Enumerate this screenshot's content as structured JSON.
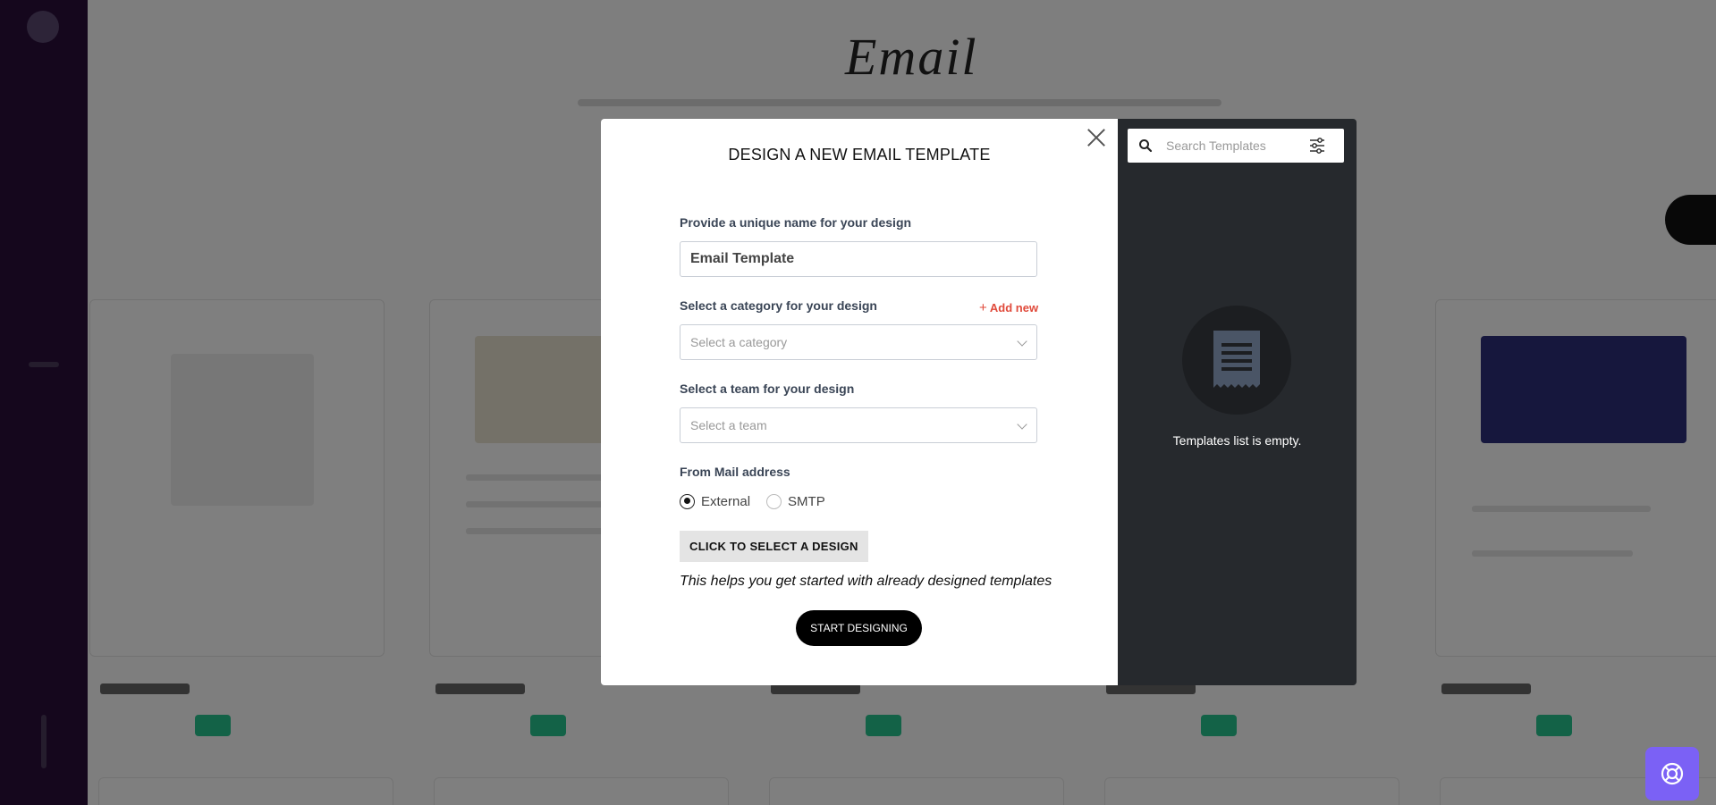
{
  "background": {
    "page_title": "Email"
  },
  "modal": {
    "title": "DESIGN A NEW EMAIL TEMPLATE",
    "name_label": "Provide a unique name for your design",
    "name_value": "Email Template",
    "category_label": "Select a category for your design",
    "add_new": "Add new",
    "category_placeholder": "Select a category",
    "team_label": "Select a team for your design",
    "team_placeholder": "Select a team",
    "from_label": "From Mail address",
    "from_options": [
      {
        "label": "External",
        "selected": true
      },
      {
        "label": "SMTP",
        "selected": false
      }
    ],
    "select_design_button": "CLICK TO SELECT A DESIGN",
    "helper_text": "This helps you get started with already designed templates",
    "start_button": "START DESIGNING"
  },
  "templates_panel": {
    "search_placeholder": "Search Templates",
    "empty_text": "Templates list is empty."
  },
  "colors": {
    "accent_red": "#e04a3b",
    "help_button": "#7b61f5",
    "panel_dark": "#26292d",
    "sidebar": "#2a0e3a"
  },
  "icons": {
    "close": "close-icon",
    "search": "search-icon",
    "filter": "filter-sliders-icon",
    "empty": "document-icon",
    "help": "lifebuoy-icon",
    "add": "plus-icon"
  }
}
